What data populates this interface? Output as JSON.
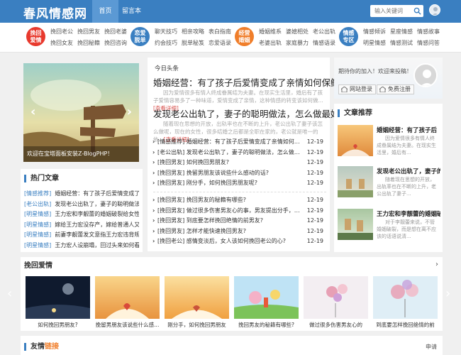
{
  "header": {
    "logo": "春风情感网",
    "nav": [
      "首页",
      "留言本"
    ],
    "search_placeholder": "输入关键词"
  },
  "categories": [
    {
      "badge": "挽回\n爱情",
      "color": "#e8392d",
      "links": [
        "挽回老公",
        "挽回男友",
        "挽回老婆",
        "挽回女友",
        "挽回秘籍",
        "挽回咨询"
      ]
    },
    {
      "badge": "恋爱\n脱单",
      "color": "#3a7fc1",
      "links": [
        "聊天技巧",
        "相亲攻略",
        "表白指南",
        "约会技巧",
        "脱单秘笈",
        "恋爱语录"
      ]
    },
    {
      "badge": "经营\n婚姻",
      "color": "#f07e2a",
      "links": [
        "婚姻维系",
        "婆媳相处",
        "老公出轨",
        "老婆出轨",
        "家庭暴力",
        "情感语录"
      ]
    },
    {
      "badge": "情感\n专区",
      "color": "#3a7fc1",
      "links": [
        "情感倾诉",
        "星座情感",
        "情感故事",
        "明星情感",
        "情感测试",
        "情感问答"
      ]
    }
  ],
  "slider": {
    "caption": "欢迎在宝塔面板安装Z-BlogPHP！"
  },
  "hot": {
    "title": "热门文章",
    "items": [
      {
        "tag": "[情感推荐]",
        "text": "婚姻经营：有了孩子后爱情变成了亲..."
      },
      {
        "tag": "[老公出轨]",
        "text": "发现老公出轨了，妻子的聪明做法，..."
      },
      {
        "tag": "[明星情感]",
        "text": "王力宏和李靓蕾的婚姻破裂给女性朋..."
      },
      {
        "tag": "[明星情感]",
        "text": "嫁给王力宏没存产，嫁给普通人又不..."
      },
      {
        "tag": "[明星情感]",
        "text": "前妻李靓蕾发文意指王力宏违背规定..."
      },
      {
        "tag": "[明星情感]",
        "text": "王力宏人设崩塌，回过头来如何看待..."
      }
    ]
  },
  "today": {
    "title": "今日头条",
    "headline1": "婚姻经营：有了孩子后爱情变成了亲情如何保鲜?",
    "excerpt1": "因为爱情很多有情人终成眷属结为夫妻。在现实生活里，婚后有了孩子爱情容易多了一种味道，爱情变成了亲情，这种情感的转变该如何做...",
    "more1": "[查看详细]",
    "headline2": "发现老公出轨了，妻子的聪明做法，怎么做最好?",
    "excerpt2": "随着现在思想的开放，出轨率也在不断的上升，老公出轨了妻子该怎么做呢，现在的女性，很多结婚之后都是全职在家的，老公就是唯一的依...",
    "more2": "[查看详细]",
    "list1": [
      {
        "t": "[情感推荐] 婚姻经营：有了孩子后爱情变成了亲情如何保鲜?",
        "d": "12-19"
      },
      {
        "t": "[老公出轨] 发现老公出轨了，妻子的聪明做法，怎么做最好?",
        "d": "12-19"
      },
      {
        "t": "[挽回男友] 如何挽回男朋友?",
        "d": "12-19"
      },
      {
        "t": "[挽回男友] 挽留男朋友该说些什么感动的话?",
        "d": "12-19"
      },
      {
        "t": "[挽回男友] 刚分手，如何挽回男朋友呢?",
        "d": "12-19"
      }
    ],
    "list2": [
      {
        "t": "[挽回男友] 挽回男友的秘籍有哪些?",
        "d": "12-19"
      },
      {
        "t": "[挽回男友] 做过很多伤害男友心的事，男友提出分手，我后...",
        "d": "12-19"
      },
      {
        "t": "[挽回男友] 到底要怎样挽回绝情的前男友?",
        "d": "12-19"
      },
      {
        "t": "[挽回男友] 怎样才能快速挽回男友?",
        "d": "12-19"
      },
      {
        "t": "[挽回老公] 感情变淡后，女人该如何挽回老公的心?",
        "d": "12-19"
      }
    ]
  },
  "login": {
    "text": "期待你的加入！欢迎来投稿！",
    "btn_login": "网站登录",
    "btn_register": "免费注册"
  },
  "recommend": {
    "title": "文章推荐",
    "items": [
      {
        "title": "婚姻经营：有了孩子后",
        "desc": "因为爱情很多有情人终成眷属结为夫妻。在现实生活里，婚后有..."
      },
      {
        "title": "发现老公出轨了，妻子的",
        "desc": "随着现在思想的开放，出轨率也在不断的上升，老公出轨了妻子..."
      },
      {
        "title": "王力宏和李靓蕾的婚姻破",
        "desc": "对于李靓蕾来说，不管婚姻破裂，而是想在离不应该的话语说清..."
      }
    ]
  },
  "recover": {
    "title": "挽回爱情",
    "items": [
      "如何挽回男朋友?",
      "挽留男朋友该说些什么感...",
      "刚分手，如何挽回男朋友",
      "挽回男友的秘籍有哪些?",
      "做过很多伤害男友心的",
      "到底要怎样挽回绝情的前"
    ]
  },
  "friend": {
    "title_a": "友情",
    "title_b": "链接",
    "apply": "申请"
  },
  "colors": {
    "brand": "#3a7fc1",
    "accent": "#f07e2a",
    "red": "#e8392d"
  }
}
